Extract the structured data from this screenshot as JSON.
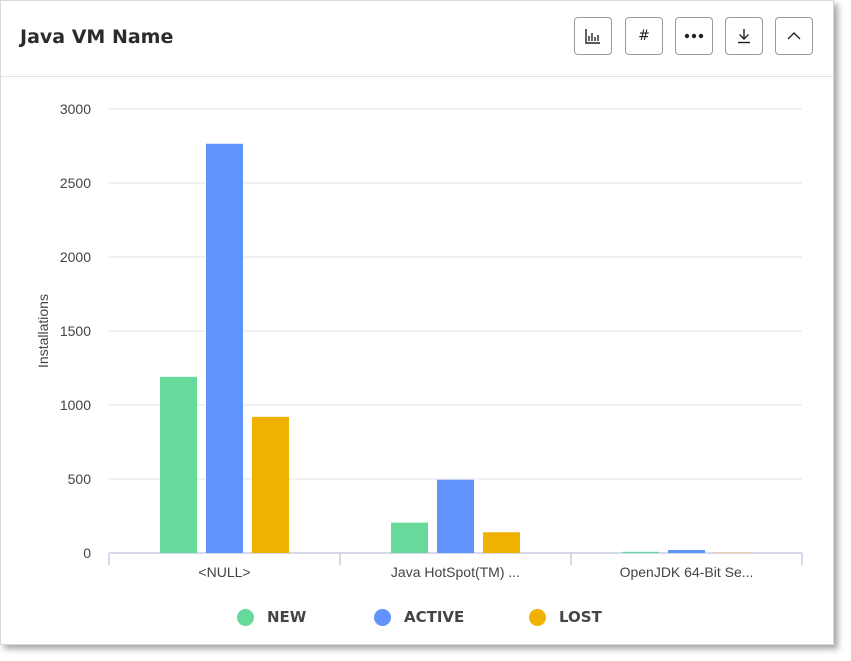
{
  "header": {
    "title": "Java VM Name",
    "buttons": [
      {
        "name": "chart-type-button",
        "icon": "bar-chart-icon"
      },
      {
        "name": "number-format-button",
        "icon": "hash-icon",
        "glyph": "#"
      },
      {
        "name": "more-options-button",
        "icon": "more-horizontal-icon"
      },
      {
        "name": "download-button",
        "icon": "download-icon"
      },
      {
        "name": "collapse-button",
        "icon": "chevron-up-icon"
      }
    ]
  },
  "colors": {
    "NEW": "#66d99b",
    "ACTIVE": "#6193fd",
    "LOST": "#f0b100",
    "grid": "#e6e6e6",
    "axis": "#c8cde0"
  },
  "chart_data": {
    "type": "bar",
    "title": "",
    "xlabel": "",
    "ylabel": "Installations",
    "categories": [
      "<NULL>",
      "Java HotSpot(TM) ...",
      "OpenJDK 64-Bit Se..."
    ],
    "series": [
      {
        "name": "NEW",
        "values": [
          1190,
          205,
          8
        ]
      },
      {
        "name": "ACTIVE",
        "values": [
          2765,
          495,
          20
        ]
      },
      {
        "name": "LOST",
        "values": [
          920,
          140,
          2
        ]
      }
    ],
    "ylim": [
      0,
      3000
    ],
    "yticks": [
      0,
      500,
      1000,
      1500,
      2000,
      2500,
      3000
    ],
    "grid": true,
    "legend_position": "bottom"
  }
}
